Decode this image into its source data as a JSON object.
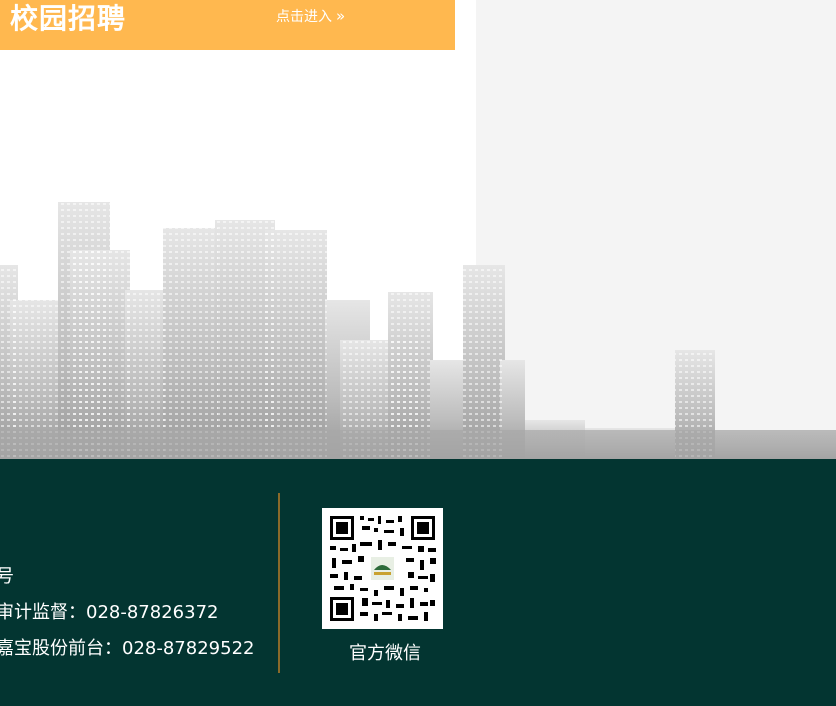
{
  "banner": {
    "title": "校园招聘",
    "link_label": "点击进入",
    "link_icon": "double-chevron-right-icon",
    "color": "#ffb84f"
  },
  "footer": {
    "background": "#033531",
    "contact_lines": [
      "号",
      "审计监督：028-87826372",
      "嘉宝股份前台：028-87829522"
    ],
    "qr_label": "官方微信"
  }
}
